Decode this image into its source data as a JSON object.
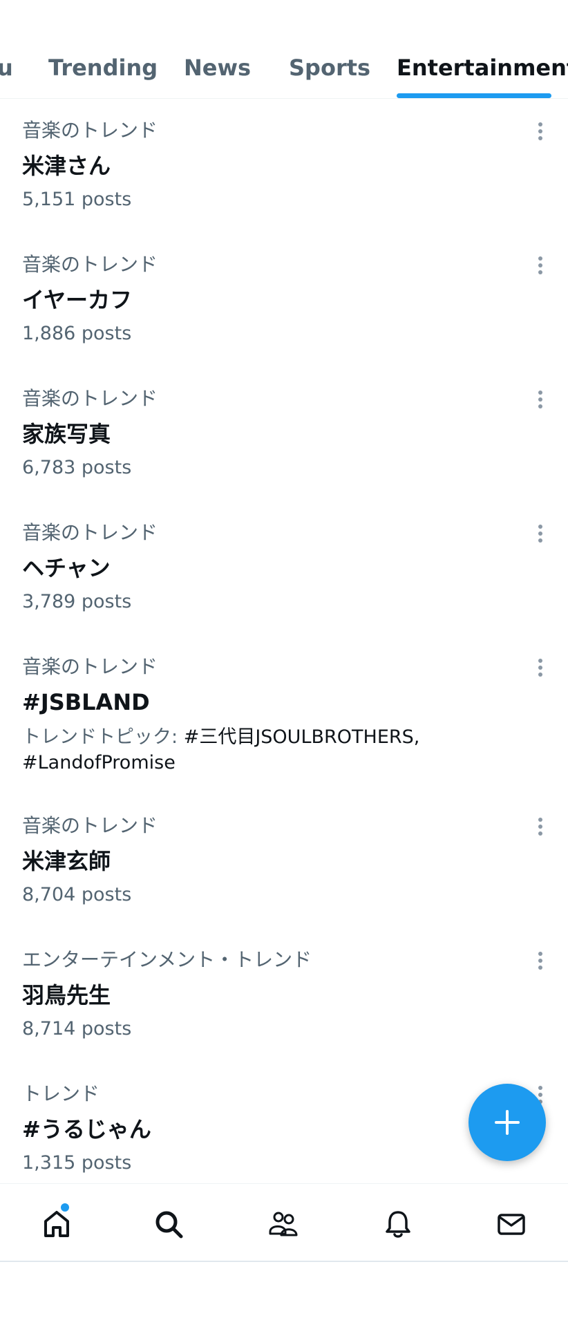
{
  "tabs": [
    {
      "label": "u"
    },
    {
      "label": "Trending"
    },
    {
      "label": "News"
    },
    {
      "label": "Sports"
    },
    {
      "label": "Entertainment",
      "active": true
    }
  ],
  "trends": [
    {
      "category": "音楽のトレンド",
      "name": "米津さん",
      "meta": "5,151 posts"
    },
    {
      "category": "音楽のトレンド",
      "name": "イヤーカフ",
      "meta": "1,886 posts"
    },
    {
      "category": "音楽のトレンド",
      "name": "家族写真",
      "meta": "6,783 posts"
    },
    {
      "category": "音楽のトレンド",
      "name": "ヘチャン",
      "meta": "3,789 posts"
    },
    {
      "category": "音楽のトレンド",
      "name": "#JSBLAND",
      "topics_label": "トレンドトピック:",
      "topics": [
        "#三代目JSOULBROTHERS,",
        "#LandofPromise"
      ]
    },
    {
      "category": "音楽のトレンド",
      "name": "米津玄師",
      "meta": "8,704 posts"
    },
    {
      "category": "エンターテインメント・トレンド",
      "name": "羽鳥先生",
      "meta": "8,714 posts"
    },
    {
      "category": "トレンド",
      "name": "#うるじゃん",
      "meta": "1,315 posts"
    }
  ],
  "fab": {
    "icon": "plus-icon"
  },
  "bottom_nav": [
    {
      "icon": "home-icon",
      "has_notification_dot": true
    },
    {
      "icon": "search-icon"
    },
    {
      "icon": "communities-icon"
    },
    {
      "icon": "notifications-icon"
    },
    {
      "icon": "messages-icon"
    }
  ],
  "colors": {
    "accent": "#1d9bf0",
    "text_primary": "#0f1419",
    "text_secondary": "#536471"
  }
}
